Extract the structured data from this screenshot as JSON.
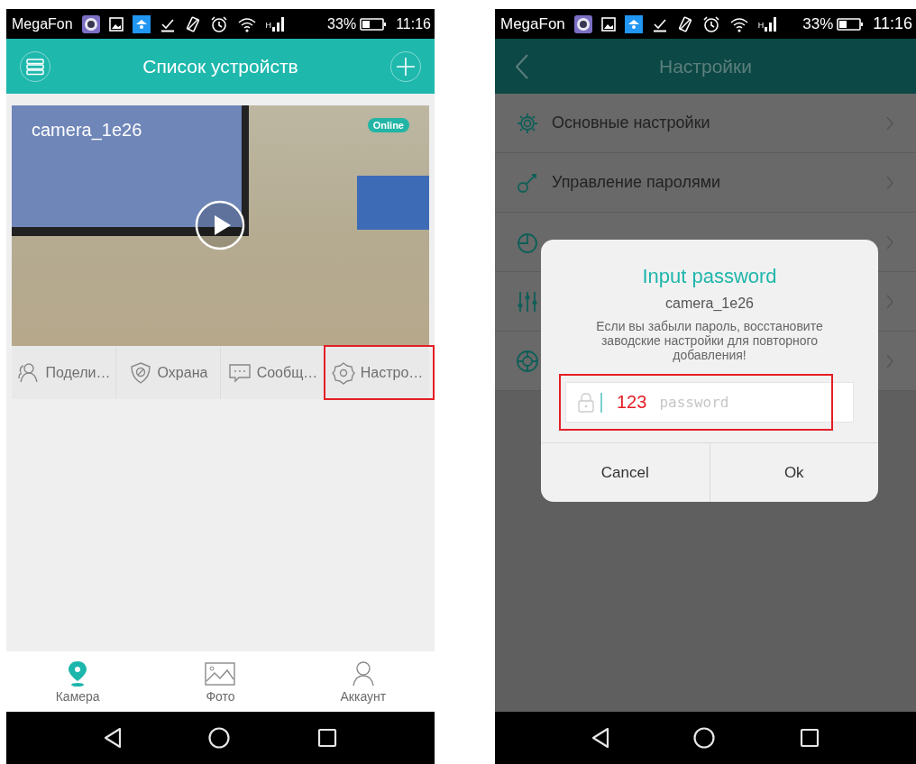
{
  "left_screen": {
    "status_bar": {
      "carrier": "MegaFon",
      "network": "H",
      "battery": "33%",
      "time": "11:16"
    },
    "header": {
      "title": "Список устройств"
    },
    "device_card": {
      "name": "camera_1e26",
      "badge": "Online",
      "actions": [
        {
          "label": "Подели…",
          "highlighted": false
        },
        {
          "label": "Охрана",
          "highlighted": false
        },
        {
          "label": "Сообщ…",
          "highlighted": false
        },
        {
          "label": "Настро…",
          "highlighted": true
        }
      ]
    },
    "tabs": [
      {
        "label": "Камера",
        "selected": true
      },
      {
        "label": "Фото",
        "selected": false
      },
      {
        "label": "Аккаунт",
        "selected": false
      }
    ]
  },
  "right_screen": {
    "status_bar": {
      "carrier": "MegaFon",
      "network": "H",
      "battery": "33%",
      "time": "11:16"
    },
    "header": {
      "title": "Настройки"
    },
    "settings_items": [
      {
        "kind": "labelled",
        "label": "Основные настройки"
      },
      {
        "kind": "labelled",
        "label": "Управление паролями"
      },
      {
        "kind": "icon_only"
      },
      {
        "kind": "icon_only"
      },
      {
        "kind": "icon_only"
      }
    ],
    "dialog": {
      "title": "Input password",
      "device": "camera_1e26",
      "message": "Если вы забыли пароль, восстановите заводские настройки для повторного добавления!",
      "field": {
        "annotation": "123",
        "placeholder": "password",
        "highlighted": true
      },
      "buttons": [
        "Cancel",
        "Ok"
      ]
    }
  }
}
